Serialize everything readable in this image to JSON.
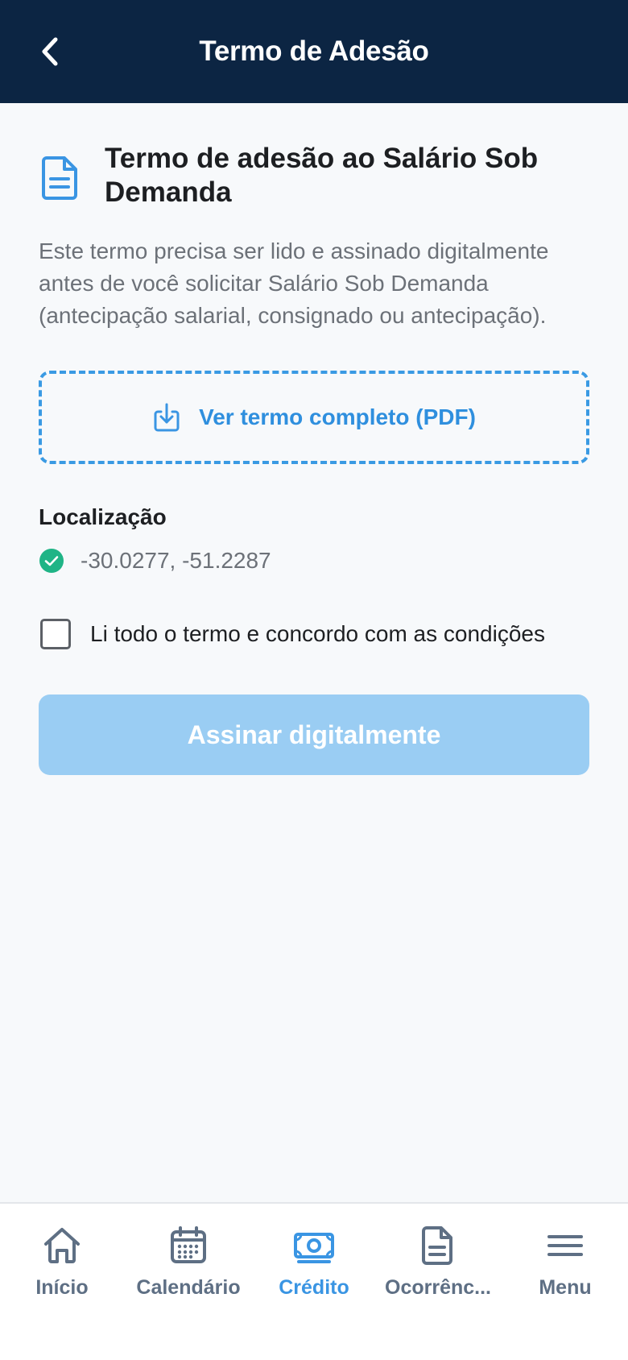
{
  "header": {
    "title": "Termo de Adesão",
    "back_icon": "chevron-left-icon"
  },
  "document": {
    "icon": "document-icon",
    "title": "Termo de adesão ao Salário Sob Demanda",
    "description": "Este termo precisa ser lido e assinado digitalmente antes de você solicitar Salário Sob Demanda (antecipação salarial, consignado ou antecipação).",
    "pdf_link_label": "Ver termo completo (PDF)",
    "pdf_icon": "download-icon"
  },
  "location": {
    "label": "Localização",
    "coordinates": "-30.0277, -51.2287",
    "status_icon": "check-circle-icon"
  },
  "agreement": {
    "label": "Li todo o termo e concordo com as condições",
    "checked": false
  },
  "sign_button": {
    "label": "Assinar digitalmente",
    "enabled": false
  },
  "tabs": [
    {
      "label": "Início",
      "icon": "home-icon",
      "active": false
    },
    {
      "label": "Calendário",
      "icon": "calendar-icon",
      "active": false
    },
    {
      "label": "Crédito",
      "icon": "money-icon",
      "active": true
    },
    {
      "label": "Ocorrênc...",
      "icon": "document-icon",
      "active": false
    },
    {
      "label": "Menu",
      "icon": "menu-icon",
      "active": false
    }
  ],
  "colors": {
    "header_bg": "#0c2543",
    "accent": "#3a95e3",
    "button_disabled": "#9acdf3",
    "success": "#1fb486"
  }
}
